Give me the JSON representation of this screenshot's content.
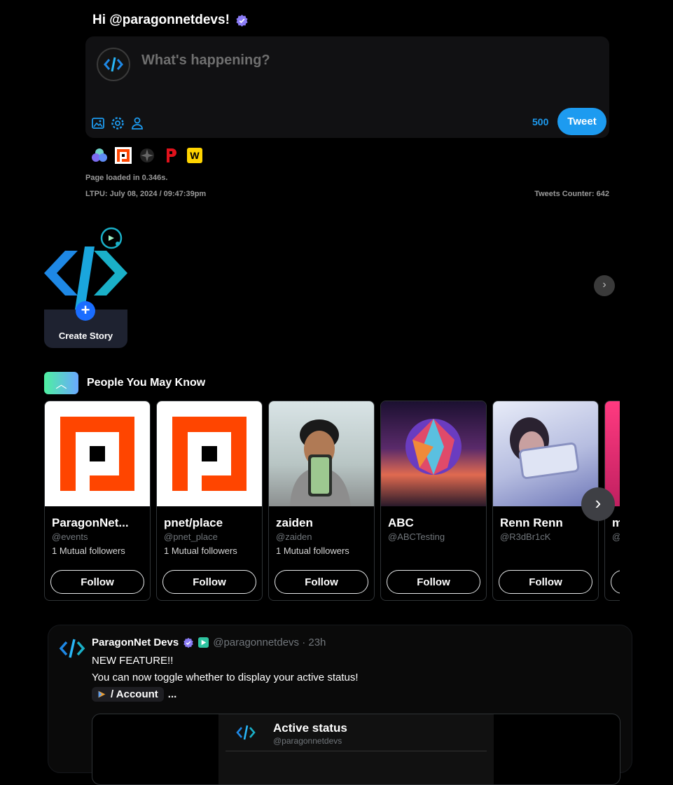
{
  "header": {
    "greeting": "Hi @paragonnetdevs!"
  },
  "composer": {
    "placeholder": "What's happening?",
    "char_count": "500",
    "tweet_label": "Tweet",
    "tools": [
      "image-icon",
      "gear-icon",
      "user-icon"
    ]
  },
  "apps": [
    "cluster-logo",
    "pnet-place-logo",
    "sparkle-logo",
    "p-red-logo",
    "w-yellow-logo"
  ],
  "meta": {
    "load_time": "Page loaded in 0.346s.",
    "ltpu": "LTPU: July 08, 2024 / 09:47:39pm",
    "tweets_counter": "Tweets Counter: 642"
  },
  "stories": {
    "create_label": "Create Story",
    "scroll_icon": "chevron-right-icon"
  },
  "pymk": {
    "title": "People You May Know",
    "people": [
      {
        "name": "ParagonNet...",
        "handle": "@events",
        "mutual": "1 Mutual followers",
        "follow": "Follow"
      },
      {
        "name": "pnet/place",
        "handle": "@pnet_place",
        "mutual": "1 Mutual followers",
        "follow": "Follow"
      },
      {
        "name": "zaiden",
        "handle": "@zaiden",
        "mutual": "1 Mutual followers",
        "follow": "Follow"
      },
      {
        "name": "ABC",
        "handle": "@ABCTesting",
        "mutual": "",
        "follow": "Follow"
      },
      {
        "name": "Renn Renn",
        "handle": "@R3dBr1cK",
        "mutual": "",
        "follow": "Follow"
      },
      {
        "name": "m",
        "handle": "@",
        "mutual": "",
        "follow": ""
      }
    ]
  },
  "post": {
    "author": "ParagonNet Devs",
    "handle_time": "@paragonnetdevs · 23h",
    "line1": "NEW FEATURE!!",
    "line2": "You can now toggle whether to display your active status!",
    "chip_text": "/ Account",
    "ellipsis": "...",
    "embed_title": "Active status",
    "embed_handle": "@paragonnetdevs"
  },
  "colors": {
    "accent": "#1d9bf0",
    "background": "#000000",
    "verified": "#8b7cf6"
  }
}
